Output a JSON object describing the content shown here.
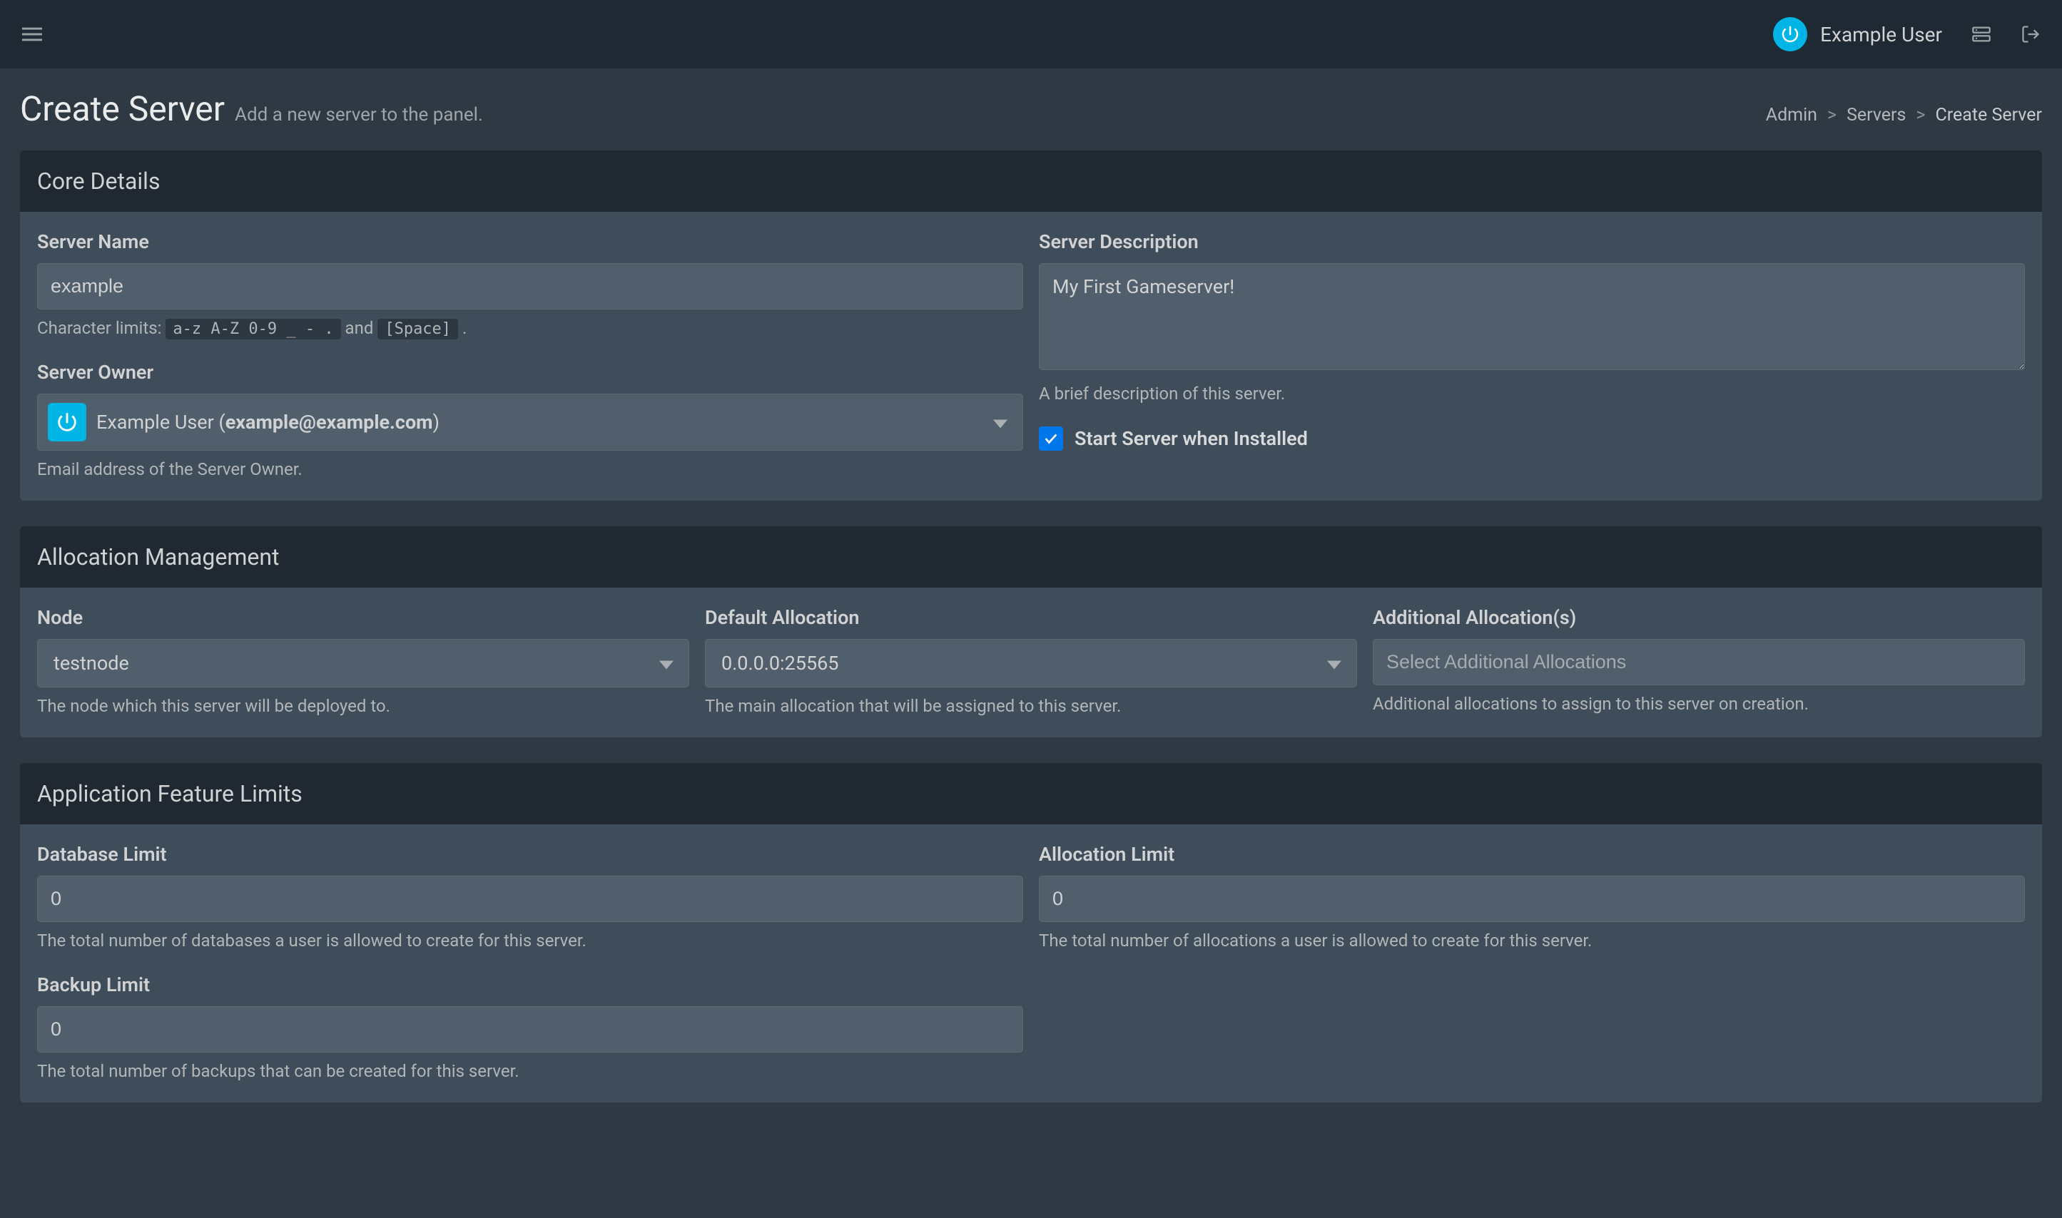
{
  "topbar": {
    "user_name": "Example User"
  },
  "header": {
    "title": "Create Server",
    "subtitle": "Add a new server to the panel."
  },
  "breadcrumb": {
    "admin": "Admin",
    "servers": "Servers",
    "current": "Create Server"
  },
  "core": {
    "title": "Core Details",
    "server_name": {
      "label": "Server Name",
      "value": "example",
      "help_prefix": "Character limits:",
      "help_code": "a-z A-Z 0-9 _ - .",
      "help_and": "and",
      "help_code2": "[Space]",
      "help_dot": "."
    },
    "server_owner": {
      "label": "Server Owner",
      "value_prefix": "Example User (",
      "value_email": "example@example.com",
      "value_suffix": ")",
      "help": "Email address of the Server Owner."
    },
    "server_description": {
      "label": "Server Description",
      "value": "My First Gameserver!",
      "help": "A brief description of this server."
    },
    "start_checkbox": {
      "label": "Start Server when Installed"
    }
  },
  "alloc": {
    "title": "Allocation Management",
    "node": {
      "label": "Node",
      "value": "testnode",
      "help": "The node which this server will be deployed to."
    },
    "default_alloc": {
      "label": "Default Allocation",
      "value": "0.0.0.0:25565",
      "help": "The main allocation that will be assigned to this server."
    },
    "additional": {
      "label": "Additional Allocation(s)",
      "placeholder": "Select Additional Allocations",
      "help": "Additional allocations to assign to this server on creation."
    }
  },
  "limits": {
    "title": "Application Feature Limits",
    "database": {
      "label": "Database Limit",
      "value": "0",
      "help": "The total number of databases a user is allowed to create for this server."
    },
    "allocation": {
      "label": "Allocation Limit",
      "value": "0",
      "help": "The total number of allocations a user is allowed to create for this server."
    },
    "backup": {
      "label": "Backup Limit",
      "value": "0",
      "help": "The total number of backups that can be created for this server."
    }
  }
}
